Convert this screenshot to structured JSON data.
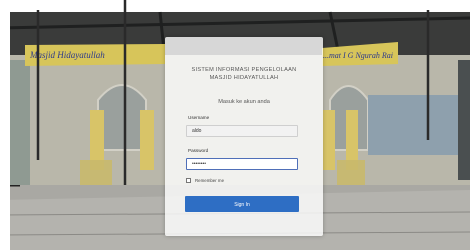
{
  "app": {
    "title": "SISTEM INFORMASI PENGELOLAAN\nMASJID HIDAYATULLAH",
    "subtitle": "Masuk ke akun anda"
  },
  "form": {
    "username_label": "Username",
    "username_value": "aldo",
    "password_label": "Password",
    "password_value": "••••••••",
    "remember_label": "Remember me",
    "signin_label": "Sign In"
  },
  "background": {
    "banner_text_left": "Masjid Hidayatullah",
    "banner_text_right": "...mat I G Ngurah Rai"
  },
  "colors": {
    "accent": "#2e6ec4",
    "focus_border": "#4f6fb8"
  }
}
